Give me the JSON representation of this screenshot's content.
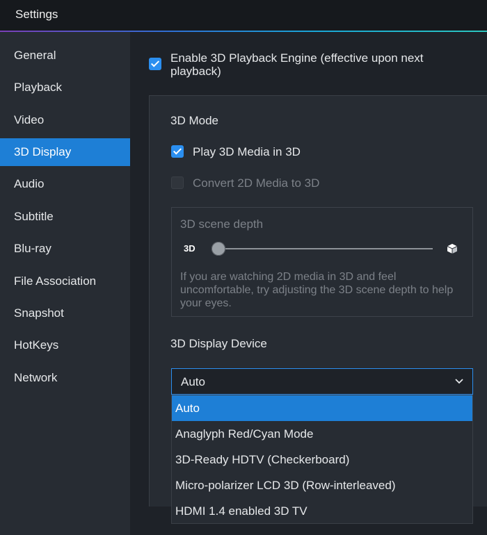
{
  "window": {
    "title": "Settings"
  },
  "sidebar": {
    "items": [
      {
        "label": "General"
      },
      {
        "label": "Playback"
      },
      {
        "label": "Video"
      },
      {
        "label": "3D Display"
      },
      {
        "label": "Audio"
      },
      {
        "label": "Subtitle"
      },
      {
        "label": "Blu-ray"
      },
      {
        "label": "File Association"
      },
      {
        "label": "Snapshot"
      },
      {
        "label": "HotKeys"
      },
      {
        "label": "Network"
      }
    ],
    "selected": "3D Display"
  },
  "main": {
    "enable_engine": {
      "line1": "Enable 3D Playback Engine (effective upon next",
      "line2": "playback)",
      "checked": true
    },
    "mode": {
      "heading": "3D Mode",
      "play_3d_label": "Play 3D Media in 3D",
      "play_3d_checked": true,
      "convert_label": "Convert 2D Media to 3D",
      "convert_checked": false,
      "convert_enabled": false
    },
    "depth": {
      "heading": "3D scene depth",
      "left_label": "3D",
      "right_icon": "cube-icon",
      "level": 0,
      "description": "If you are watching 2D media in 3D and feel uncomfortable, try adjusting the 3D scene depth to help your eyes."
    },
    "device": {
      "heading": "3D Display Device",
      "selected": "Auto",
      "options": [
        "Auto",
        "Anaglyph Red/Cyan Mode",
        "3D-Ready HDTV (Checkerboard)",
        "Micro-polarizer LCD 3D (Row-interleaved)",
        "HDMI 1.4 enabled 3D TV"
      ]
    }
  },
  "colors": {
    "accent": "#1e7fd6",
    "checkbox": "#2b8ff0",
    "background": "#1e2228",
    "panel": "#272c33"
  }
}
